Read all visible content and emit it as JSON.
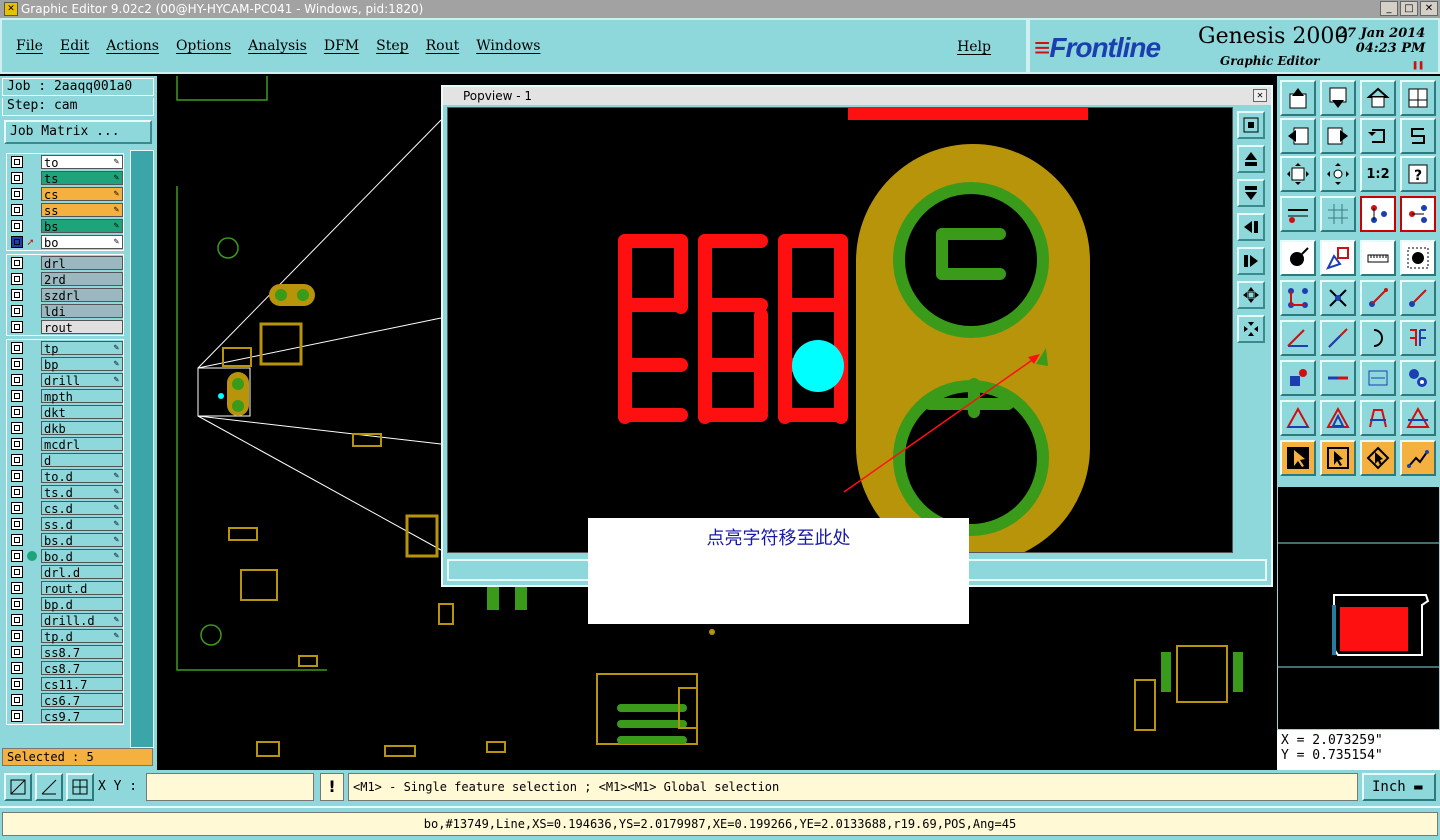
{
  "window": {
    "title": "Graphic Editor 9.02c2 (00@HY-HYCAM-PC041 - Windows, pid:1820)"
  },
  "menu": {
    "items": [
      "File",
      "Edit",
      "Actions",
      "Options",
      "Analysis",
      "DFM",
      "Step",
      "Rout",
      "Windows"
    ],
    "help": "Help"
  },
  "brand": {
    "logo_main": "Front",
    "logo_accent": "line",
    "product": "Genesis 2000",
    "subtitle": "Graphic Editor",
    "date": "27 Jan 2014",
    "time": "04:23 PM"
  },
  "job": {
    "job_label": "Job : 2aaqq001a0",
    "step_label": "Step: cam",
    "matrix_button": "Job Matrix ..."
  },
  "layers": {
    "group1": [
      {
        "name": "to",
        "color": "#ffffff"
      },
      {
        "name": "ts",
        "color": "#1fa37a"
      },
      {
        "name": "cs",
        "color": "#f5b13f"
      },
      {
        "name": "ss",
        "color": "#f5b13f"
      },
      {
        "name": "bs",
        "color": "#1fa37a"
      },
      {
        "name": "bo",
        "color": "#ffffff"
      }
    ],
    "group2": [
      {
        "name": "drl",
        "color": "#9bb8c0"
      },
      {
        "name": "2rd",
        "color": "#9bb8c0"
      },
      {
        "name": "szdrl",
        "color": "#9bb8c0"
      },
      {
        "name": "ldi",
        "color": "#9bb8c0"
      },
      {
        "name": "rout",
        "color": "#e0e0e0"
      }
    ],
    "group3": [
      {
        "name": "tp"
      },
      {
        "name": "bp"
      },
      {
        "name": "drill"
      },
      {
        "name": "mpth"
      },
      {
        "name": "dkt"
      },
      {
        "name": "dkb"
      },
      {
        "name": "mcdrl"
      },
      {
        "name": "d"
      },
      {
        "name": "to.d"
      },
      {
        "name": "ts.d"
      },
      {
        "name": "cs.d"
      },
      {
        "name": "ss.d"
      },
      {
        "name": "bs.d"
      },
      {
        "name": "bo.d"
      },
      {
        "name": "drl.d"
      },
      {
        "name": "rout.d"
      },
      {
        "name": "bp.d"
      },
      {
        "name": "drill.d"
      },
      {
        "name": "tp.d"
      },
      {
        "name": "ss8.7"
      },
      {
        "name": "cs8.7"
      },
      {
        "name": "cs11.7"
      },
      {
        "name": "cs6.7"
      },
      {
        "name": "cs9.7"
      }
    ]
  },
  "selected": "Selected : 5",
  "popview": {
    "title": "Popview - 1"
  },
  "annotation": "点亮字符移至此处",
  "coords": {
    "x": "X = 2.073259\"",
    "y": "Y = 0.735154\""
  },
  "status": {
    "xy_label": "X Y :",
    "xy_value": "",
    "hint": "<M1> - Single feature selection ; <M1><M1> Global selection",
    "unit": "Inch",
    "feature_info": "bo,#13749,Line,XS=0.194636,YS=2.0179987,XE=0.199266,YE=2.0133688,r19.69,POS,Ang=45"
  },
  "colors": {
    "panel": "#8ed8dc",
    "silkscreen_red": "#ff1010",
    "pad_gold": "#b8940a",
    "pad_green": "#3a9a1a",
    "highlight": "#00ffff"
  }
}
